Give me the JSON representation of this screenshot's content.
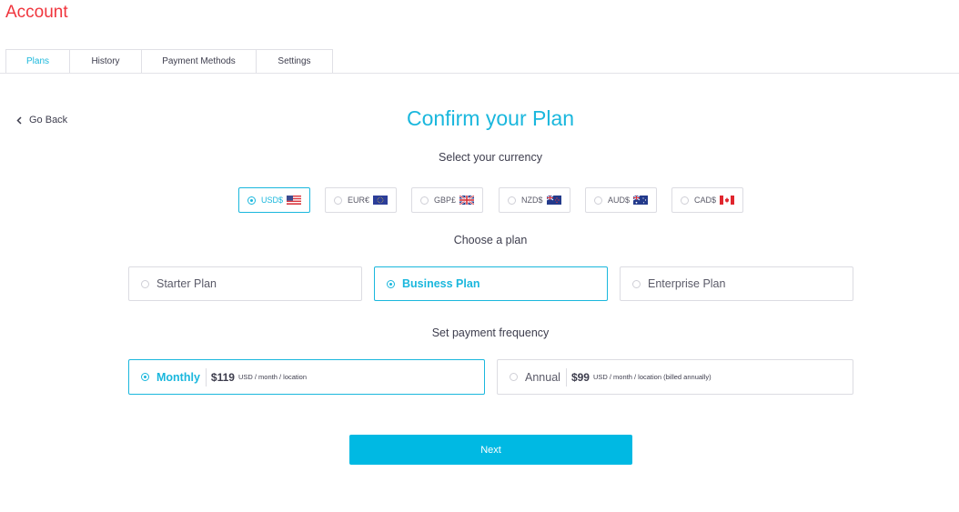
{
  "page": {
    "title": "Account"
  },
  "tabs": [
    {
      "label": "Plans",
      "active": true
    },
    {
      "label": "History",
      "active": false
    },
    {
      "label": "Payment Methods",
      "active": false
    },
    {
      "label": "Settings",
      "active": false
    }
  ],
  "nav": {
    "go_back": "Go Back"
  },
  "main": {
    "heading": "Confirm your Plan",
    "currency_label": "Select your currency",
    "plan_label": "Choose a plan",
    "frequency_label": "Set payment frequency"
  },
  "currencies": [
    {
      "code": "USD$",
      "flag": "us-flag-icon",
      "selected": true
    },
    {
      "code": "EUR€",
      "flag": "eu-flag-icon",
      "selected": false
    },
    {
      "code": "GBP£",
      "flag": "uk-flag-icon",
      "selected": false
    },
    {
      "code": "NZD$",
      "flag": "nz-flag-icon",
      "selected": false
    },
    {
      "code": "AUD$",
      "flag": "au-flag-icon",
      "selected": false
    },
    {
      "code": "CAD$",
      "flag": "ca-flag-icon",
      "selected": false
    }
  ],
  "plans": [
    {
      "label": "Starter Plan",
      "selected": false
    },
    {
      "label": "Business Plan",
      "selected": true
    },
    {
      "label": "Enterprise Plan",
      "selected": false
    }
  ],
  "frequencies": [
    {
      "label": "Monthly",
      "price": "$119",
      "unit": "USD / month / location",
      "selected": true
    },
    {
      "label": "Annual",
      "price": "$99",
      "unit": "USD / month / location (billed annually)",
      "selected": false
    }
  ],
  "actions": {
    "next": "Next"
  },
  "colors": {
    "brand_red": "#f0353d",
    "accent": "#1ab7dd",
    "button": "#00b9e3"
  }
}
